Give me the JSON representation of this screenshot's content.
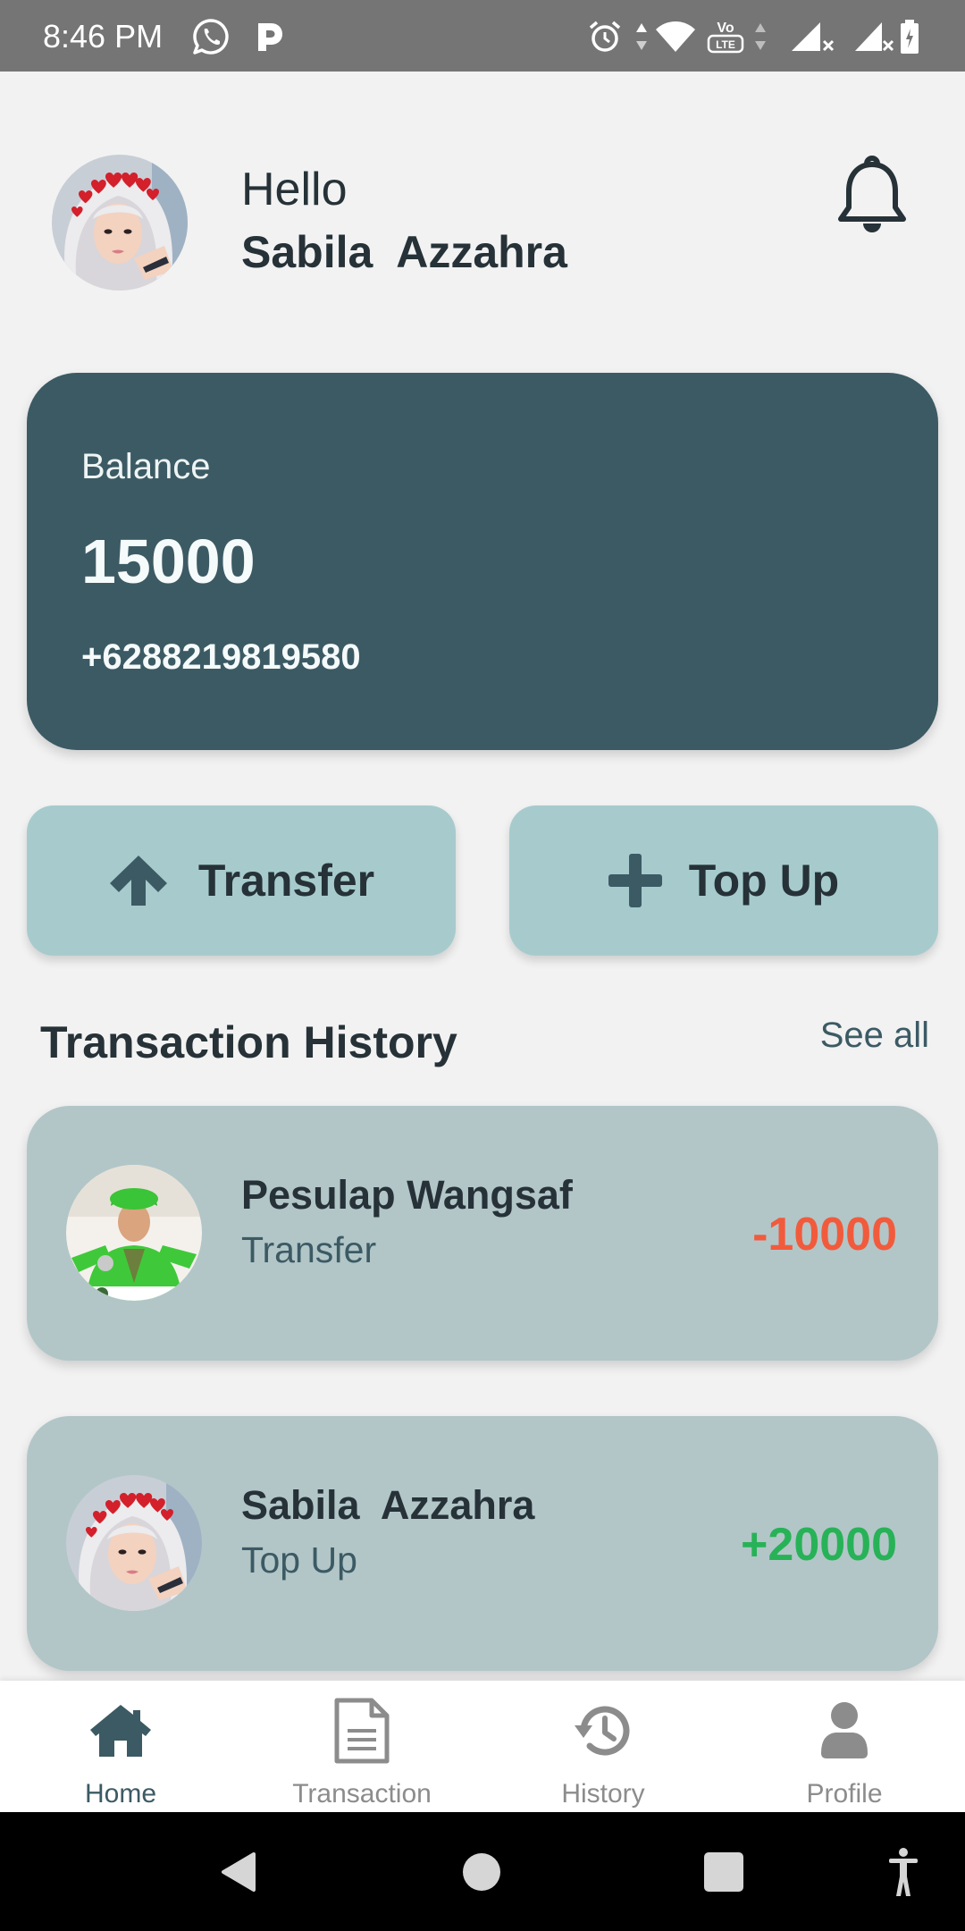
{
  "status_bar": {
    "time": "8:46 PM",
    "volte_top": "Vo",
    "volte_bottom": "LTE",
    "icons": [
      "whatsapp-icon",
      "p-app-icon",
      "alarm-icon",
      "data-arrows-icon",
      "wifi-icon",
      "volte-icon",
      "data-arrows-icon",
      "signal-icon",
      "signal-icon",
      "battery-icon"
    ]
  },
  "header": {
    "greeting": "Hello",
    "user_name": "Sabila  Azzahra",
    "notification_icon": "bell-icon"
  },
  "balance_card": {
    "label": "Balance",
    "amount": "15000",
    "phone": "+6288219819580"
  },
  "actions": {
    "transfer": {
      "label": "Transfer",
      "icon": "arrow-up-icon"
    },
    "top_up": {
      "label": "Top Up",
      "icon": "plus-icon"
    }
  },
  "history": {
    "title": "Transaction History",
    "see_all": "See all",
    "items": [
      {
        "name": "Pesulap Wangsaf",
        "type": "Transfer",
        "amount": "-10000",
        "amount_color": "#f15b3c"
      },
      {
        "name": "Sabila  Azzahra",
        "type": "Top Up",
        "amount": "+20000",
        "amount_color": "#28b257"
      }
    ]
  },
  "bottom_nav": {
    "items": [
      {
        "label": "Home",
        "icon": "home-icon",
        "active": true
      },
      {
        "label": "Transaction",
        "icon": "document-icon",
        "active": false
      },
      {
        "label": "History",
        "icon": "history-icon",
        "active": false
      },
      {
        "label": "Profile",
        "icon": "profile-icon",
        "active": false
      }
    ]
  },
  "system_nav": {
    "buttons": [
      "back-icon",
      "home-circle-icon",
      "recents-icon",
      "accessibility-icon"
    ]
  },
  "colors": {
    "primary": "#3c5a64",
    "page_bg": "#f2f2f2",
    "button_bg": "#a7cbcd",
    "card_bg": "#b2c6c8",
    "debit": "#f15b3c",
    "credit": "#28b257",
    "nav_active": "#3c5a64",
    "nav_inactive": "#8c8c8c"
  }
}
